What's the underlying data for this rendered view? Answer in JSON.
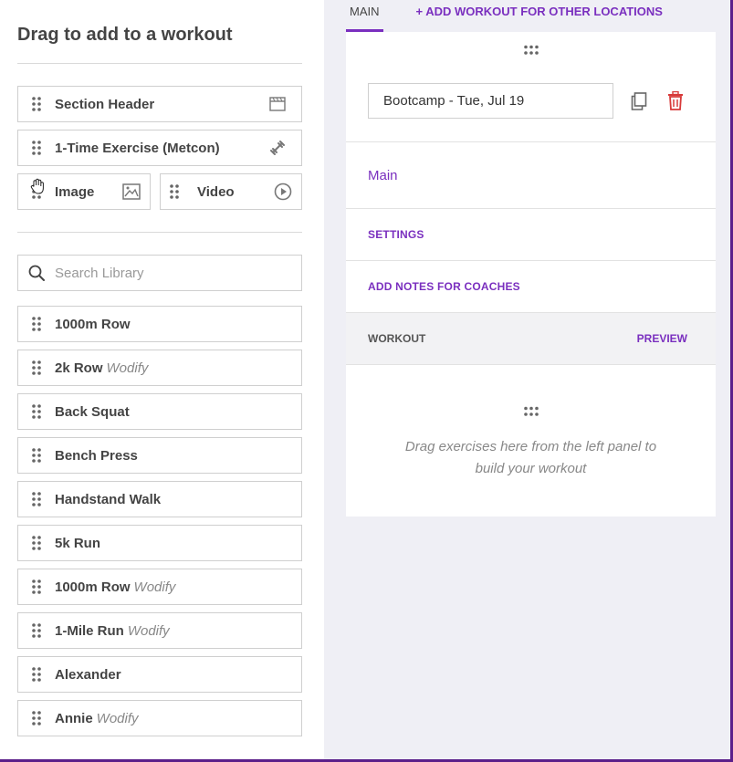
{
  "left_panel": {
    "title": "Drag to add to a workout",
    "blocks": {
      "section_header": "Section Header",
      "one_time_exercise": "1-Time Exercise (Metcon)",
      "image": "Image",
      "video": "Video"
    },
    "search": {
      "placeholder": "Search Library",
      "value": ""
    },
    "library": [
      {
        "name": "1000m Row",
        "tag": ""
      },
      {
        "name": "2k Row",
        "tag": "Wodify"
      },
      {
        "name": "Back Squat",
        "tag": ""
      },
      {
        "name": "Bench Press",
        "tag": ""
      },
      {
        "name": "Handstand Walk",
        "tag": ""
      },
      {
        "name": "5k Run",
        "tag": ""
      },
      {
        "name": "1000m Row",
        "tag": "Wodify"
      },
      {
        "name": "1-Mile Run",
        "tag": "Wodify"
      },
      {
        "name": "Alexander",
        "tag": ""
      },
      {
        "name": "Annie",
        "tag": "Wodify"
      }
    ]
  },
  "right_panel": {
    "tabs": {
      "main": "MAIN",
      "add_location": "+ ADD WORKOUT FOR OTHER LOCATIONS"
    },
    "workout_title": "Bootcamp - Tue, Jul 19",
    "section_main": "Main",
    "settings_label": "SETTINGS",
    "notes_label": "ADD NOTES FOR COACHES",
    "workout_label": "WORKOUT",
    "preview_label": "PREVIEW",
    "drop_hint": "Drag exercises here from the left panel to build your workout"
  },
  "icons": {
    "grip": "grip-dots-icon",
    "section_header": "section-header-icon",
    "dumbbell": "dumbbell-icon",
    "image": "image-icon",
    "video": "play-circle-icon",
    "search": "search-icon",
    "copy": "copy-icon",
    "trash": "trash-icon",
    "cursor": "grab-hand-cursor-icon"
  },
  "colors": {
    "accent": "#7a2fbf",
    "danger": "#d83a3a",
    "frame": "#5b1f8a"
  }
}
